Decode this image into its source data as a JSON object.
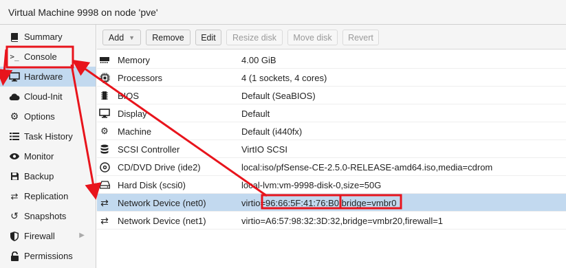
{
  "window": {
    "title": "Virtual Machine 9998 on node 'pve'"
  },
  "sidebar": {
    "items": [
      {
        "label": "Summary"
      },
      {
        "label": "Console"
      },
      {
        "label": "Hardware"
      },
      {
        "label": "Cloud-Init"
      },
      {
        "label": "Options"
      },
      {
        "label": "Task History"
      },
      {
        "label": "Monitor"
      },
      {
        "label": "Backup"
      },
      {
        "label": "Replication"
      },
      {
        "label": "Snapshots"
      },
      {
        "label": "Firewall"
      },
      {
        "label": "Permissions"
      }
    ],
    "console_prompt": ">_"
  },
  "toolbar": {
    "add": "Add",
    "remove": "Remove",
    "edit": "Edit",
    "resize_disk": "Resize disk",
    "move_disk": "Move disk",
    "revert": "Revert"
  },
  "hardware": {
    "rows": [
      {
        "name": "Memory",
        "value": "4.00 GiB"
      },
      {
        "name": "Processors",
        "value": "4 (1 sockets, 4 cores)"
      },
      {
        "name": "BIOS",
        "value": "Default (SeaBIOS)"
      },
      {
        "name": "Display",
        "value": "Default"
      },
      {
        "name": "Machine",
        "value": "Default (i440fx)"
      },
      {
        "name": "SCSI Controller",
        "value": "VirtIO SCSI"
      },
      {
        "name": "CD/DVD Drive (ide2)",
        "value": "local:iso/pfSense-CE-2.5.0-RELEASE-amd64.iso,media=cdrom"
      },
      {
        "name": "Hard Disk (scsi0)",
        "value": "local-lvm:vm-9998-disk-0,size=50G"
      },
      {
        "name": "Network Device (net0)",
        "value_prefix": "virtio=",
        "value_mac": "96:66:5F:41:76:B0",
        "value_suffix": ",bridge=vmbr0"
      },
      {
        "name": "Network Device (net1)",
        "value": "virtio=A6:57:98:32:3D:32,bridge=vmbr20,firewall=1"
      }
    ]
  },
  "colors": {
    "selected": "#c2d9ef",
    "annotation": "#e8141c"
  }
}
